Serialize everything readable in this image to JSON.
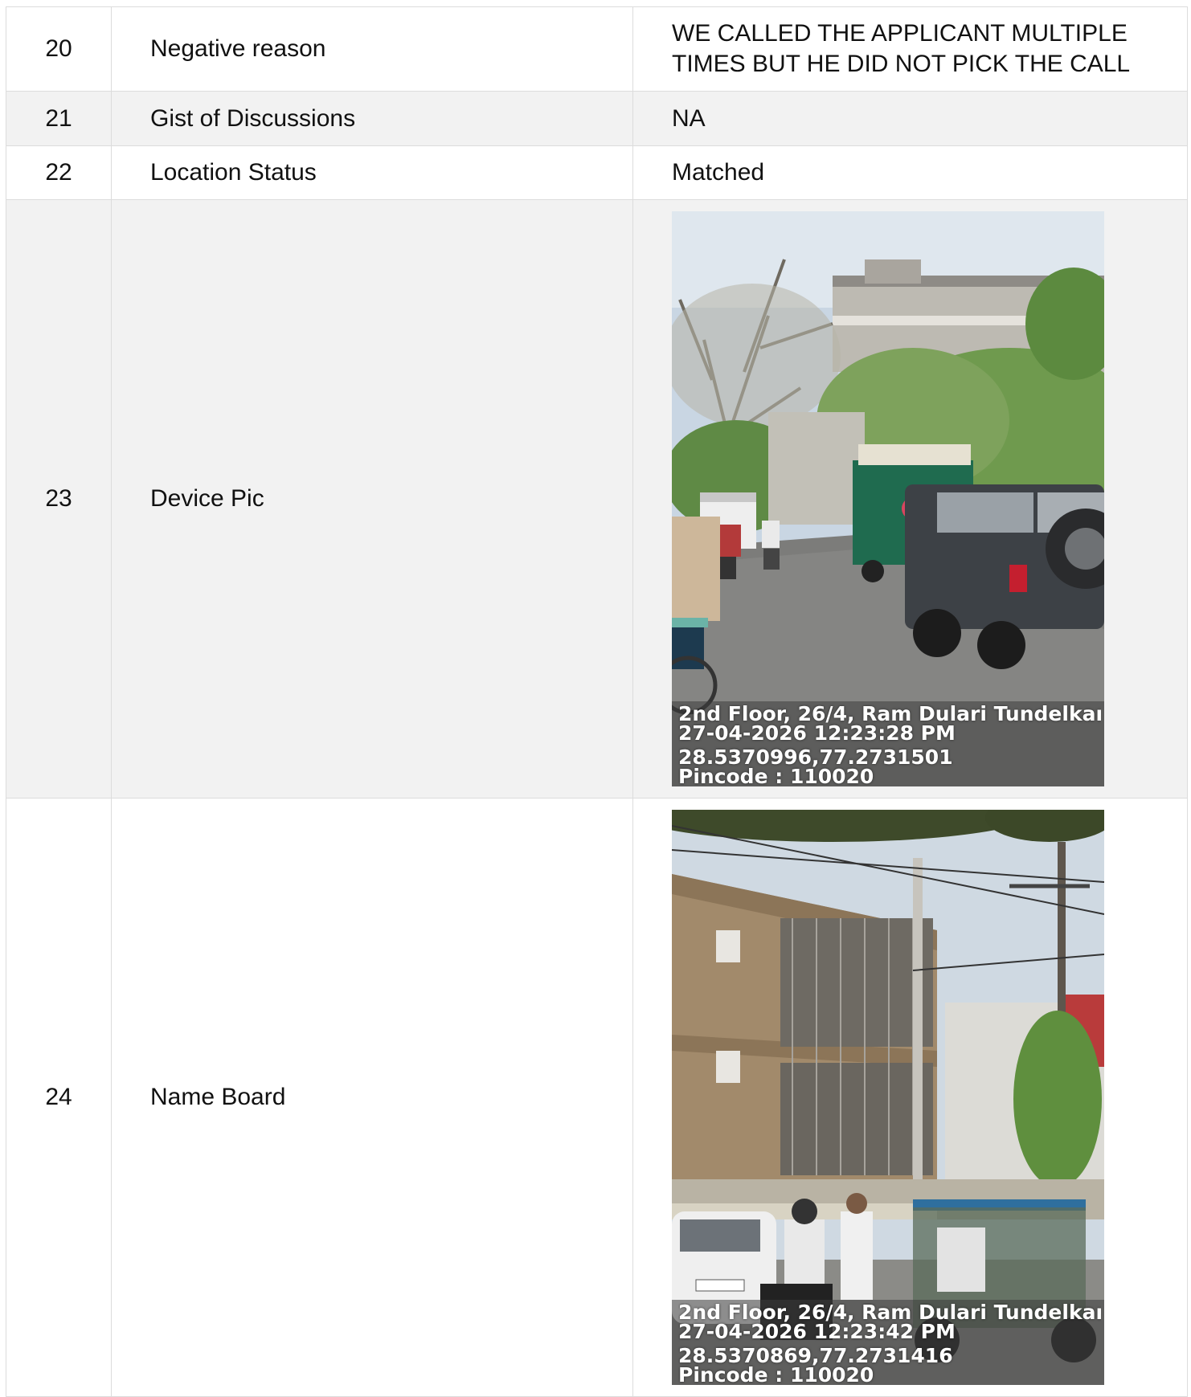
{
  "rows": [
    {
      "num": "20",
      "label": "Negative reason",
      "value": "WE CALLED THE APPLICANT MULTIPLE TIMES BUT HE DID NOT PICK THE CALL"
    },
    {
      "num": "21",
      "label": "Gist of Discussions",
      "value": "NA"
    },
    {
      "num": "22",
      "label": "Location Status",
      "value": "Matched"
    },
    {
      "num": "23",
      "label": "Device Pic",
      "photo": {
        "address": "2nd Floor, 26/4, Ram Dulari Tundelkar ...",
        "datetime": "27-04-2026 12:23:28 PM",
        "coords": "28.5370996,77.2731501",
        "pincode": "Pincode : 110020"
      }
    },
    {
      "num": "24",
      "label": "Name Board",
      "photo": {
        "address": "2nd Floor, 26/4, Ram Dulari Tundelkar ...",
        "datetime": "27-04-2026 12:23:42 PM",
        "coords": "28.5370869,77.2731416",
        "pincode": "Pincode : 110020"
      }
    }
  ]
}
